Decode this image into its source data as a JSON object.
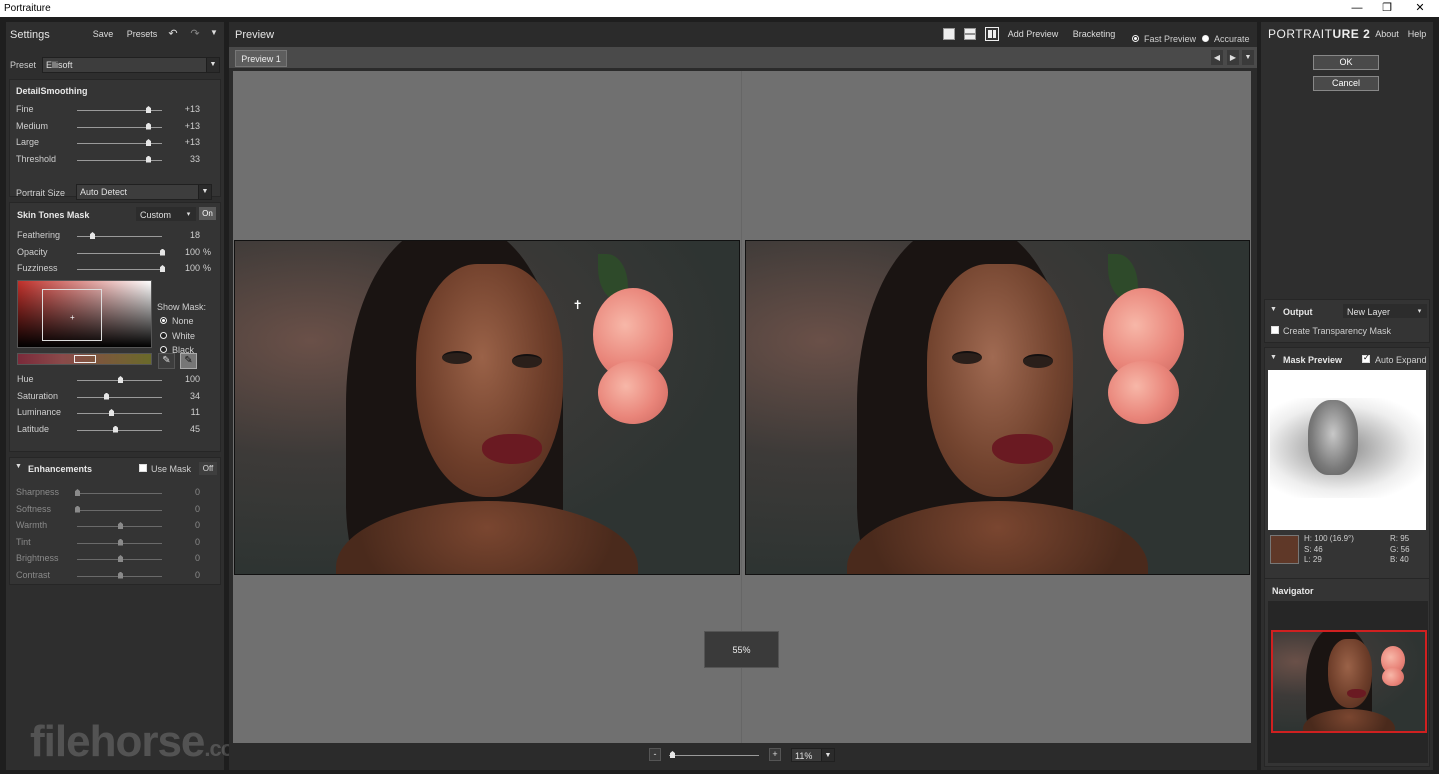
{
  "window": {
    "title": "Portraiture"
  },
  "settings": {
    "title": "Settings",
    "save": "Save",
    "presets": "Presets",
    "preset_label": "Preset",
    "preset_value": "Ellisoft"
  },
  "detail": {
    "title": "DetailSmoothing",
    "sliders": [
      {
        "label": "Fine",
        "value": "+13",
        "level": 0.83
      },
      {
        "label": "Medium",
        "value": "+13",
        "level": 0.83
      },
      {
        "label": "Large",
        "value": "+13",
        "level": 0.83
      },
      {
        "label": "Threshold",
        "value": "33",
        "level": 0.83
      }
    ],
    "portrait_size_label": "Portrait Size",
    "portrait_size_value": "Auto Detect"
  },
  "skin": {
    "title": "Skin Tones Mask",
    "mode": "Custom",
    "state": "On",
    "sliders": [
      {
        "label": "Feathering",
        "value": "18",
        "unit": "",
        "level": 0.18
      },
      {
        "label": "Opacity",
        "value": "100",
        "unit": "%",
        "level": 1.0
      },
      {
        "label": "Fuzziness",
        "value": "100",
        "unit": "%",
        "level": 1.0
      }
    ],
    "show_mask_label": "Show Mask:",
    "mask_options": [
      "None",
      "White",
      "Black"
    ],
    "mask_selected": "None",
    "hsl": [
      {
        "label": "Hue",
        "value": "100",
        "level": 0.5
      },
      {
        "label": "Saturation",
        "value": "34",
        "level": 0.34
      },
      {
        "label": "Luminance",
        "value": "11",
        "level": 0.4
      },
      {
        "label": "Latitude",
        "value": "45",
        "level": 0.45
      }
    ],
    "color_base": "#c0302a"
  },
  "enh": {
    "title": "Enhancements",
    "use_mask": "Use Mask",
    "state": "Off",
    "sliders": [
      {
        "label": "Sharpness",
        "value": "0",
        "level": 0.0
      },
      {
        "label": "Softness",
        "value": "0",
        "level": 0.0
      },
      {
        "label": "Warmth",
        "value": "0",
        "level": 0.5
      },
      {
        "label": "Tint",
        "value": "0",
        "level": 0.5
      },
      {
        "label": "Brightness",
        "value": "0",
        "level": 0.5
      },
      {
        "label": "Contrast",
        "value": "0",
        "level": 0.5
      }
    ]
  },
  "preview": {
    "title": "Preview",
    "add_preview": "Add Preview",
    "bracketing": "Bracketing",
    "fast_preview": "Fast Preview",
    "accurate": "Accurate",
    "tab": "Preview 1",
    "zoom_overlay": "55%",
    "zoom": "11%"
  },
  "right": {
    "logo_a": "PORTRAIT",
    "logo_b": "URE 2",
    "about": "About",
    "help": "Help",
    "ok": "OK",
    "cancel": "Cancel",
    "output_title": "Output",
    "output_value": "New Layer",
    "create_mask": "Create Transparency Mask",
    "mask_preview_title": "Mask Preview",
    "auto_expand": "Auto Expand",
    "swatch_color": "#5f3828",
    "h": "H: 100 (16.9°)",
    "s": "S: 46",
    "l": "L: 29",
    "r": "R: 95",
    "g": "G: 56",
    "b": "B: 40",
    "navigator": "Navigator"
  },
  "watermark": {
    "brand": "filehorse",
    "tld": ".com"
  }
}
